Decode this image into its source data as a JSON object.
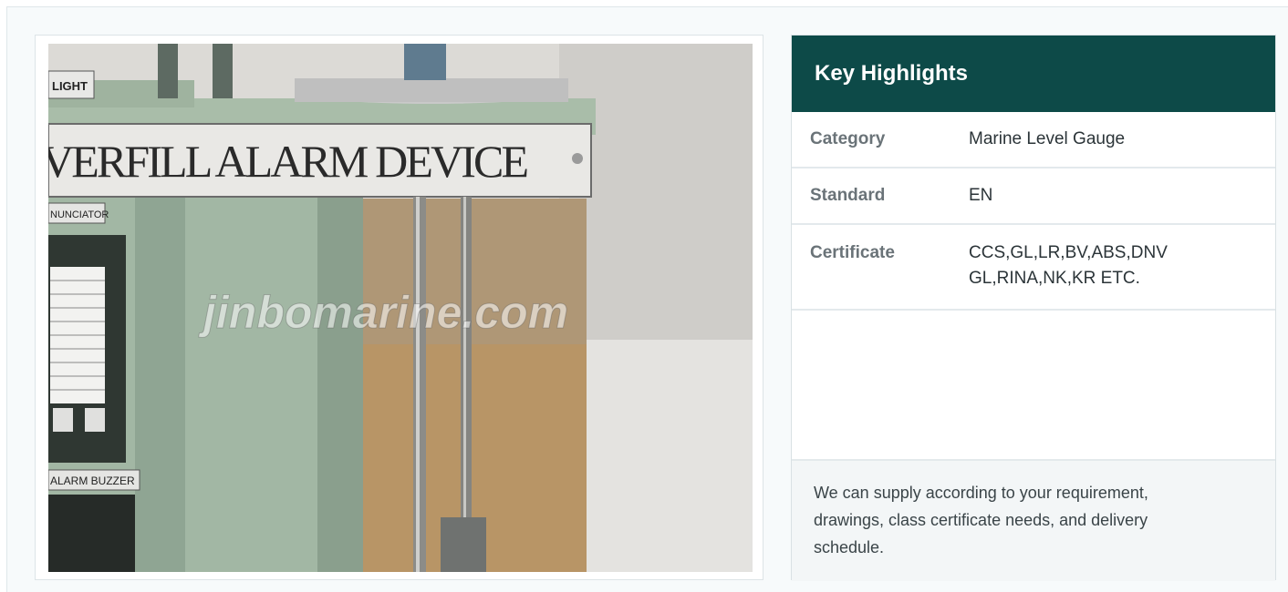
{
  "photo": {
    "alt": "Overfill alarm device photo",
    "sign_text": "VERFILL ALARM DEVICE",
    "light_label": "LIGHT",
    "annunciator_label": "NUNCIATOR",
    "buzzer_label": "ALARM BUZZER",
    "watermark": "jinbomarine.com"
  },
  "highlights": {
    "title": "Key Highlights",
    "rows": [
      {
        "label": "Category",
        "value": "Marine Level Gauge"
      },
      {
        "label": "Standard",
        "value": "EN"
      },
      {
        "label": "Certificate",
        "value": "CCS,GL,LR,BV,ABS,DNV GL,RINA,NK,KR ETC."
      }
    ],
    "note": "We can supply according to your requirement, drawings, class certificate needs, and delivery schedule."
  },
  "colors": {
    "header_bg": "#0d4a48",
    "device_green": "#9fb5a0",
    "note_bg": "#f3f6f7"
  }
}
